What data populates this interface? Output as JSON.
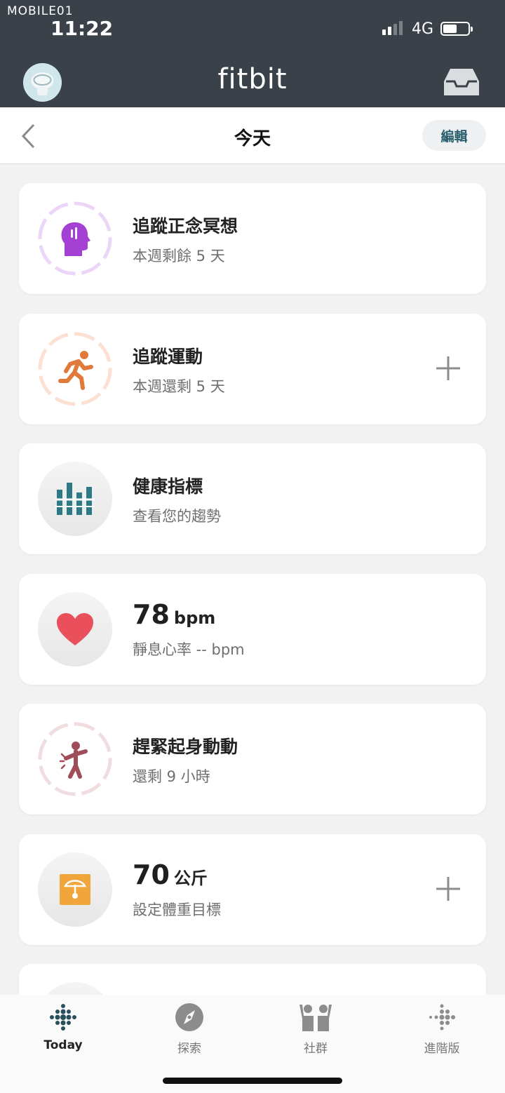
{
  "status": {
    "watermark": "MOBILE01",
    "time": "11:22",
    "network": "4G"
  },
  "header": {
    "brand": "fitbit",
    "avatar_icon": "avatar-icon",
    "inbox_icon": "inbox-icon"
  },
  "subheader": {
    "title": "今天",
    "edit_label": "編輯",
    "back_icon": "chevron-left-icon"
  },
  "cards": [
    {
      "title": "追蹤正念冥想",
      "sub": "本週剩餘 5 天",
      "icon": "mindfulness-head-icon",
      "color": "#a540d4",
      "has_plus": false
    },
    {
      "title": "追蹤運動",
      "sub": "本週還剩 5 天",
      "icon": "running-icon",
      "color": "#e07a3a",
      "has_plus": true
    },
    {
      "title": "健康指標",
      "sub": "查看您的趨勢",
      "icon": "health-metrics-icon",
      "color": "#2d7a86",
      "has_plus": false
    },
    {
      "value": "78",
      "unit": "bpm",
      "sub": "靜息心率 -- bpm",
      "icon": "heart-icon",
      "color": "#e9505b",
      "has_plus": false
    },
    {
      "title": "趕緊起身動動",
      "sub": "還剩 9 小時",
      "icon": "stand-up-icon",
      "color": "#a04d5a",
      "has_plus": false
    },
    {
      "value": "70",
      "unit": "公斤",
      "sub": "設定體重目標",
      "icon": "scale-icon",
      "color": "#f0a63a",
      "has_plus": true
    }
  ],
  "nav": [
    {
      "label": "Today",
      "icon": "today-dots-icon",
      "active": true
    },
    {
      "label": "探索",
      "icon": "compass-icon",
      "active": false
    },
    {
      "label": "社群",
      "icon": "community-icon",
      "active": false
    },
    {
      "label": "進階版",
      "icon": "premium-dots-icon",
      "active": false
    }
  ]
}
